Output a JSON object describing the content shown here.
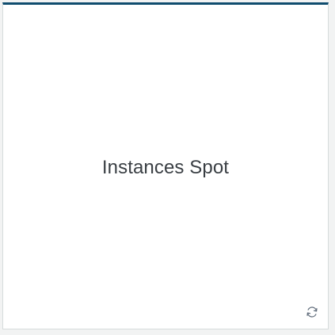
{
  "card": {
    "title": "Instances Spot",
    "accent_color": "#0f4c6e",
    "refresh_icon": "refresh-icon"
  }
}
